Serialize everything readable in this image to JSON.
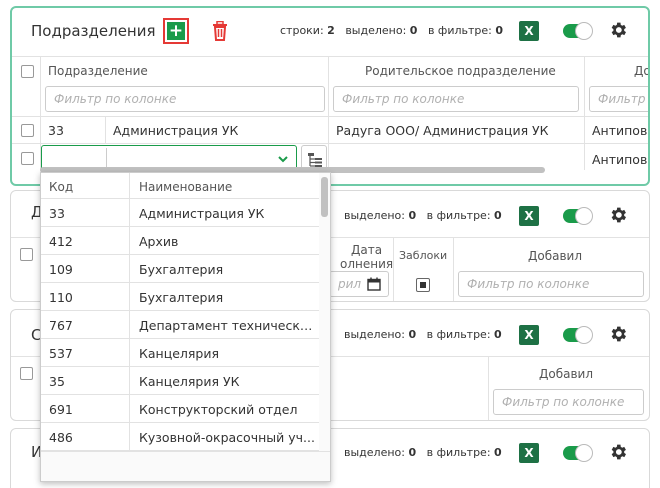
{
  "panel1": {
    "title": "Подразделения",
    "stats": {
      "rows_label": "строки:",
      "rows": "2",
      "selected_label": "выделено:",
      "selected": "0",
      "filtered_label": "в фильтре:",
      "filtered": "0"
    },
    "xls_label": "X",
    "columns": {
      "subdivision": "Подразделение",
      "parent": "Родительское подразделение",
      "cut": "До"
    },
    "filter_placeholder": "Фильтр по колонке",
    "filter_placeholder_cut": "Фильтр по",
    "rows": [
      {
        "code": "33",
        "name": "Администрация УК",
        "parent": "Радуга ООО/ Администрация УК",
        "author": "Антипов"
      },
      {
        "code": "",
        "name": "",
        "parent": "",
        "author": "Антипов"
      }
    ]
  },
  "dropdown": {
    "col_code": "Код",
    "col_name": "Наименование",
    "items": [
      {
        "code": "33",
        "name": "Администрация УК"
      },
      {
        "code": "412",
        "name": "Архив"
      },
      {
        "code": "109",
        "name": "Бухгалтерия"
      },
      {
        "code": "110",
        "name": "Бухгалтерия"
      },
      {
        "code": "767",
        "name": "Департамент техническо..."
      },
      {
        "code": "537",
        "name": "Канцелярия"
      },
      {
        "code": "35",
        "name": "Канцелярия УК"
      },
      {
        "code": "691",
        "name": "Конструкторский отдел"
      },
      {
        "code": "486",
        "name": "Кузовной-окрасочный уч..."
      }
    ]
  },
  "panel2": {
    "title": "Д",
    "stats": {
      "selected_label": "выделено:",
      "selected": "0",
      "filtered_label": "в фильтре:",
      "filtered": "0"
    },
    "xls_label": "X",
    "columns": {
      "date_line1": "Дата",
      "date_line2": "олнения",
      "blocked": "Заблоки",
      "added": "Добавил"
    },
    "date_filter_cut": "рил",
    "filter_placeholder": "Фильтр по колонке"
  },
  "panel3": {
    "title": "С",
    "stats": {
      "selected_label": "выделено:",
      "selected": "0",
      "filtered_label": "в фильтре:",
      "filtered": "0"
    },
    "xls_label": "X",
    "columns": {
      "added": "Добавил"
    },
    "filter_placeholder": "Фильтр по колонке"
  },
  "panel4": {
    "title": "И",
    "stats": {
      "selected_label": "выделено:",
      "selected": "0",
      "filtered_label": "в фильтре:",
      "filtered": "0"
    },
    "xls_label": "X"
  },
  "colors": {
    "accent_green": "#1a9b4a",
    "excel_green": "#1e7145",
    "delete_red": "#e53935",
    "active_border": "#6fcaa7"
  }
}
